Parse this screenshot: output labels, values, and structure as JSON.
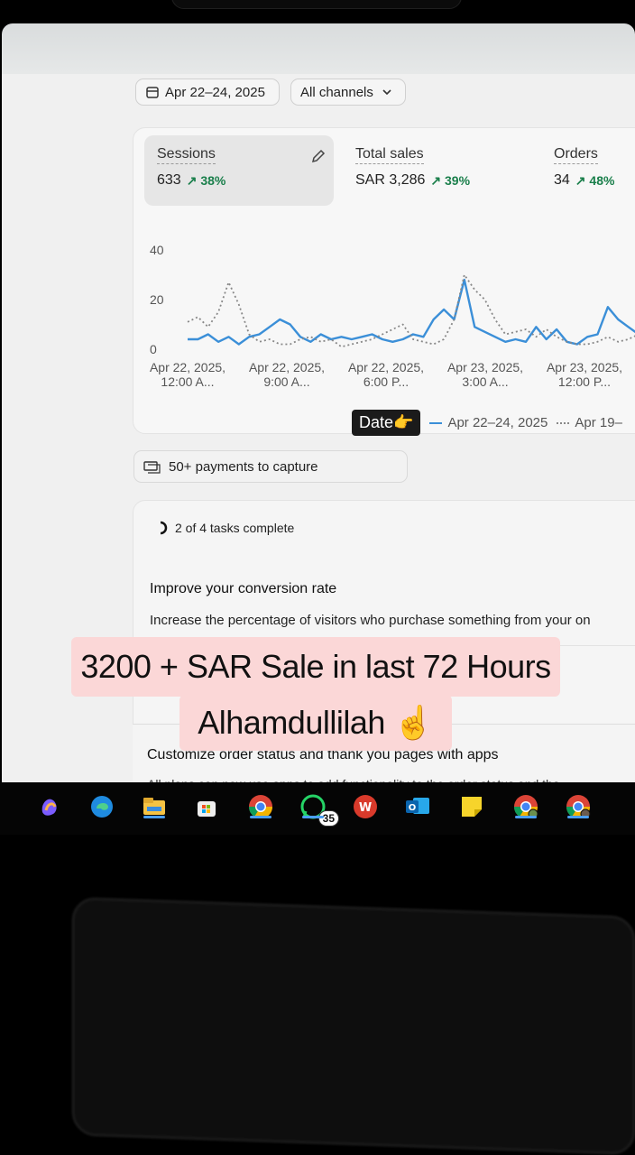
{
  "header": {
    "date_range": "Apr 22–24, 2025",
    "channel": "All channels"
  },
  "metrics": [
    {
      "label": "Sessions",
      "value": "633",
      "change": "↗ 38%"
    },
    {
      "label": "Total sales",
      "value": "SAR 3,286",
      "change": "↗ 39%"
    },
    {
      "label": "Orders",
      "value": "34",
      "change": "↗ 48%"
    }
  ],
  "chart_data": {
    "type": "line",
    "yticks": [
      "40",
      "20",
      "0"
    ],
    "ylim": [
      0,
      40
    ],
    "xticks": [
      [
        "Apr 22, 2025,",
        "12:00 A..."
      ],
      [
        "Apr 22, 2025,",
        "9:00 A..."
      ],
      [
        "Apr 22, 2025,",
        "6:00 P..."
      ],
      [
        "Apr 23, 2025,",
        "3:00 A..."
      ],
      [
        "Apr 23, 2025,",
        "12:00 P..."
      ]
    ],
    "series": [
      {
        "name": "Apr 22–24, 2025",
        "style": "solid",
        "color": "#3b8fd8",
        "values": [
          4,
          4,
          6,
          3,
          5,
          2,
          5,
          6,
          9,
          12,
          10,
          5,
          3,
          6,
          4,
          5,
          4,
          5,
          6,
          4,
          3,
          4,
          6,
          5,
          12,
          16,
          12,
          28,
          9,
          7,
          5,
          3,
          4,
          3,
          9,
          4,
          8,
          3,
          2,
          5,
          6,
          17,
          12,
          9,
          6
        ]
      },
      {
        "name": "Apr 19–",
        "style": "dotted",
        "color": "#888888",
        "values": [
          11,
          13,
          9,
          15,
          27,
          18,
          6,
          3,
          4,
          2,
          2,
          4,
          5,
          3,
          4,
          1,
          2,
          3,
          4,
          6,
          8,
          10,
          4,
          3,
          2,
          4,
          12,
          30,
          24,
          20,
          12,
          6,
          7,
          8,
          5,
          8,
          5,
          3,
          2,
          2,
          3,
          5,
          3,
          4,
          6
        ]
      }
    ],
    "legend": {
      "tag": "Date👉",
      "placement": "bottom"
    }
  },
  "payments": {
    "label": "50+ payments to capture"
  },
  "tasks": {
    "status": "2 of 4 tasks complete",
    "title": "Improve your conversion rate",
    "description": "Increase the percentage of visitors who purchase something from your on"
  },
  "customize": {
    "title": "Customize order status and thank you pages with apps",
    "description": "All plans can now use apps to add functionality to the order status and tha"
  },
  "caption": {
    "line1": "3200 + SAR Sale in last 72 Hours",
    "line2": "Alhamdullilah ☝️"
  },
  "taskbar": {
    "icons": [
      "copilot-icon",
      "edge-icon",
      "file-explorer-icon",
      "store-icon",
      "chrome-icon",
      "whatsapp-icon",
      "wps-office-icon",
      "outlook-icon",
      "sticky-notes-icon",
      "chrome-profile-icon",
      "chrome-profile-n-icon"
    ],
    "whatsapp_badge": "35"
  }
}
